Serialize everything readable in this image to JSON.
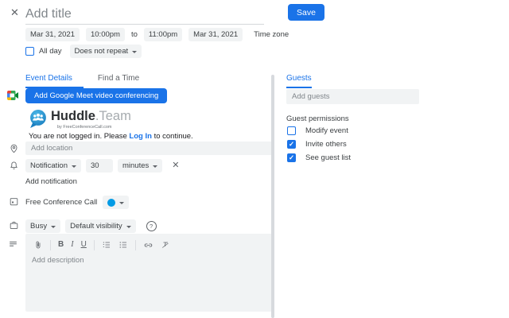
{
  "header": {
    "title_placeholder": "Add title",
    "save_label": "Save"
  },
  "datetime": {
    "start_date": "Mar 31, 2021",
    "start_time": "10:00pm",
    "to_label": "to",
    "end_time": "11:00pm",
    "end_date": "Mar 31, 2021",
    "timezone_label": "Time zone",
    "all_day_label": "All day",
    "all_day_checked": false,
    "recurrence_value": "Does not repeat"
  },
  "tabs": {
    "event_details": "Event Details",
    "find_a_time": "Find a Time"
  },
  "conferencing": {
    "meet_button_label": "Add Google Meet video conferencing",
    "huddle_brand": "Huddle",
    "huddle_brand_suffix": ".Team",
    "huddle_tagline": "by FreeConferenceCall.com",
    "login_prefix": "You are not logged in. Please",
    "login_link": "Log In",
    "login_suffix": "to continue."
  },
  "location": {
    "placeholder": "Add location"
  },
  "notification": {
    "type_value": "Notification",
    "amount_value": "30",
    "unit_value": "minutes",
    "add_label": "Add notification"
  },
  "calendar": {
    "name": "Free Conference Call",
    "color_swatch": "#039be5"
  },
  "status": {
    "busy_value": "Busy",
    "visibility_value": "Default visibility"
  },
  "description": {
    "placeholder": "Add description",
    "toolbar_glyphs": {
      "bold": "B",
      "italic": "I",
      "underline": "U"
    },
    "toolbar_icons": [
      "attach-icon",
      "bold",
      "italic",
      "underline",
      "numbered-list-icon",
      "bulleted-list-icon",
      "link-icon",
      "clear-formatting-icon"
    ]
  },
  "guests": {
    "tab_label": "Guests",
    "placeholder": "Add guests",
    "permissions_title": "Guest permissions",
    "permissions": [
      {
        "label": "Modify event",
        "checked": false
      },
      {
        "label": "Invite others",
        "checked": true
      },
      {
        "label": "See guest list",
        "checked": true
      }
    ]
  },
  "icons": {
    "close": "✕",
    "check": "✓",
    "help": "?",
    "svg_icon_names": [
      "google-meet-icon",
      "huddle-logo-icon",
      "location-pin-icon",
      "bell-icon",
      "calendar-icon",
      "briefcase-icon",
      "description-lines-icon",
      "attach-icon",
      "numbered-list-icon",
      "bulleted-list-icon",
      "link-icon",
      "clear-formatting-icon",
      "dropdown-arrow-icon"
    ]
  },
  "colors": {
    "accent": "#1a73e8",
    "chip_background": "#f1f3f4",
    "calendar_swatch": "#039be5",
    "huddle_blue": "#2aa0d8",
    "text_primary": "#3c4043",
    "text_muted": "#5f6368",
    "placeholder": "#80868b"
  }
}
